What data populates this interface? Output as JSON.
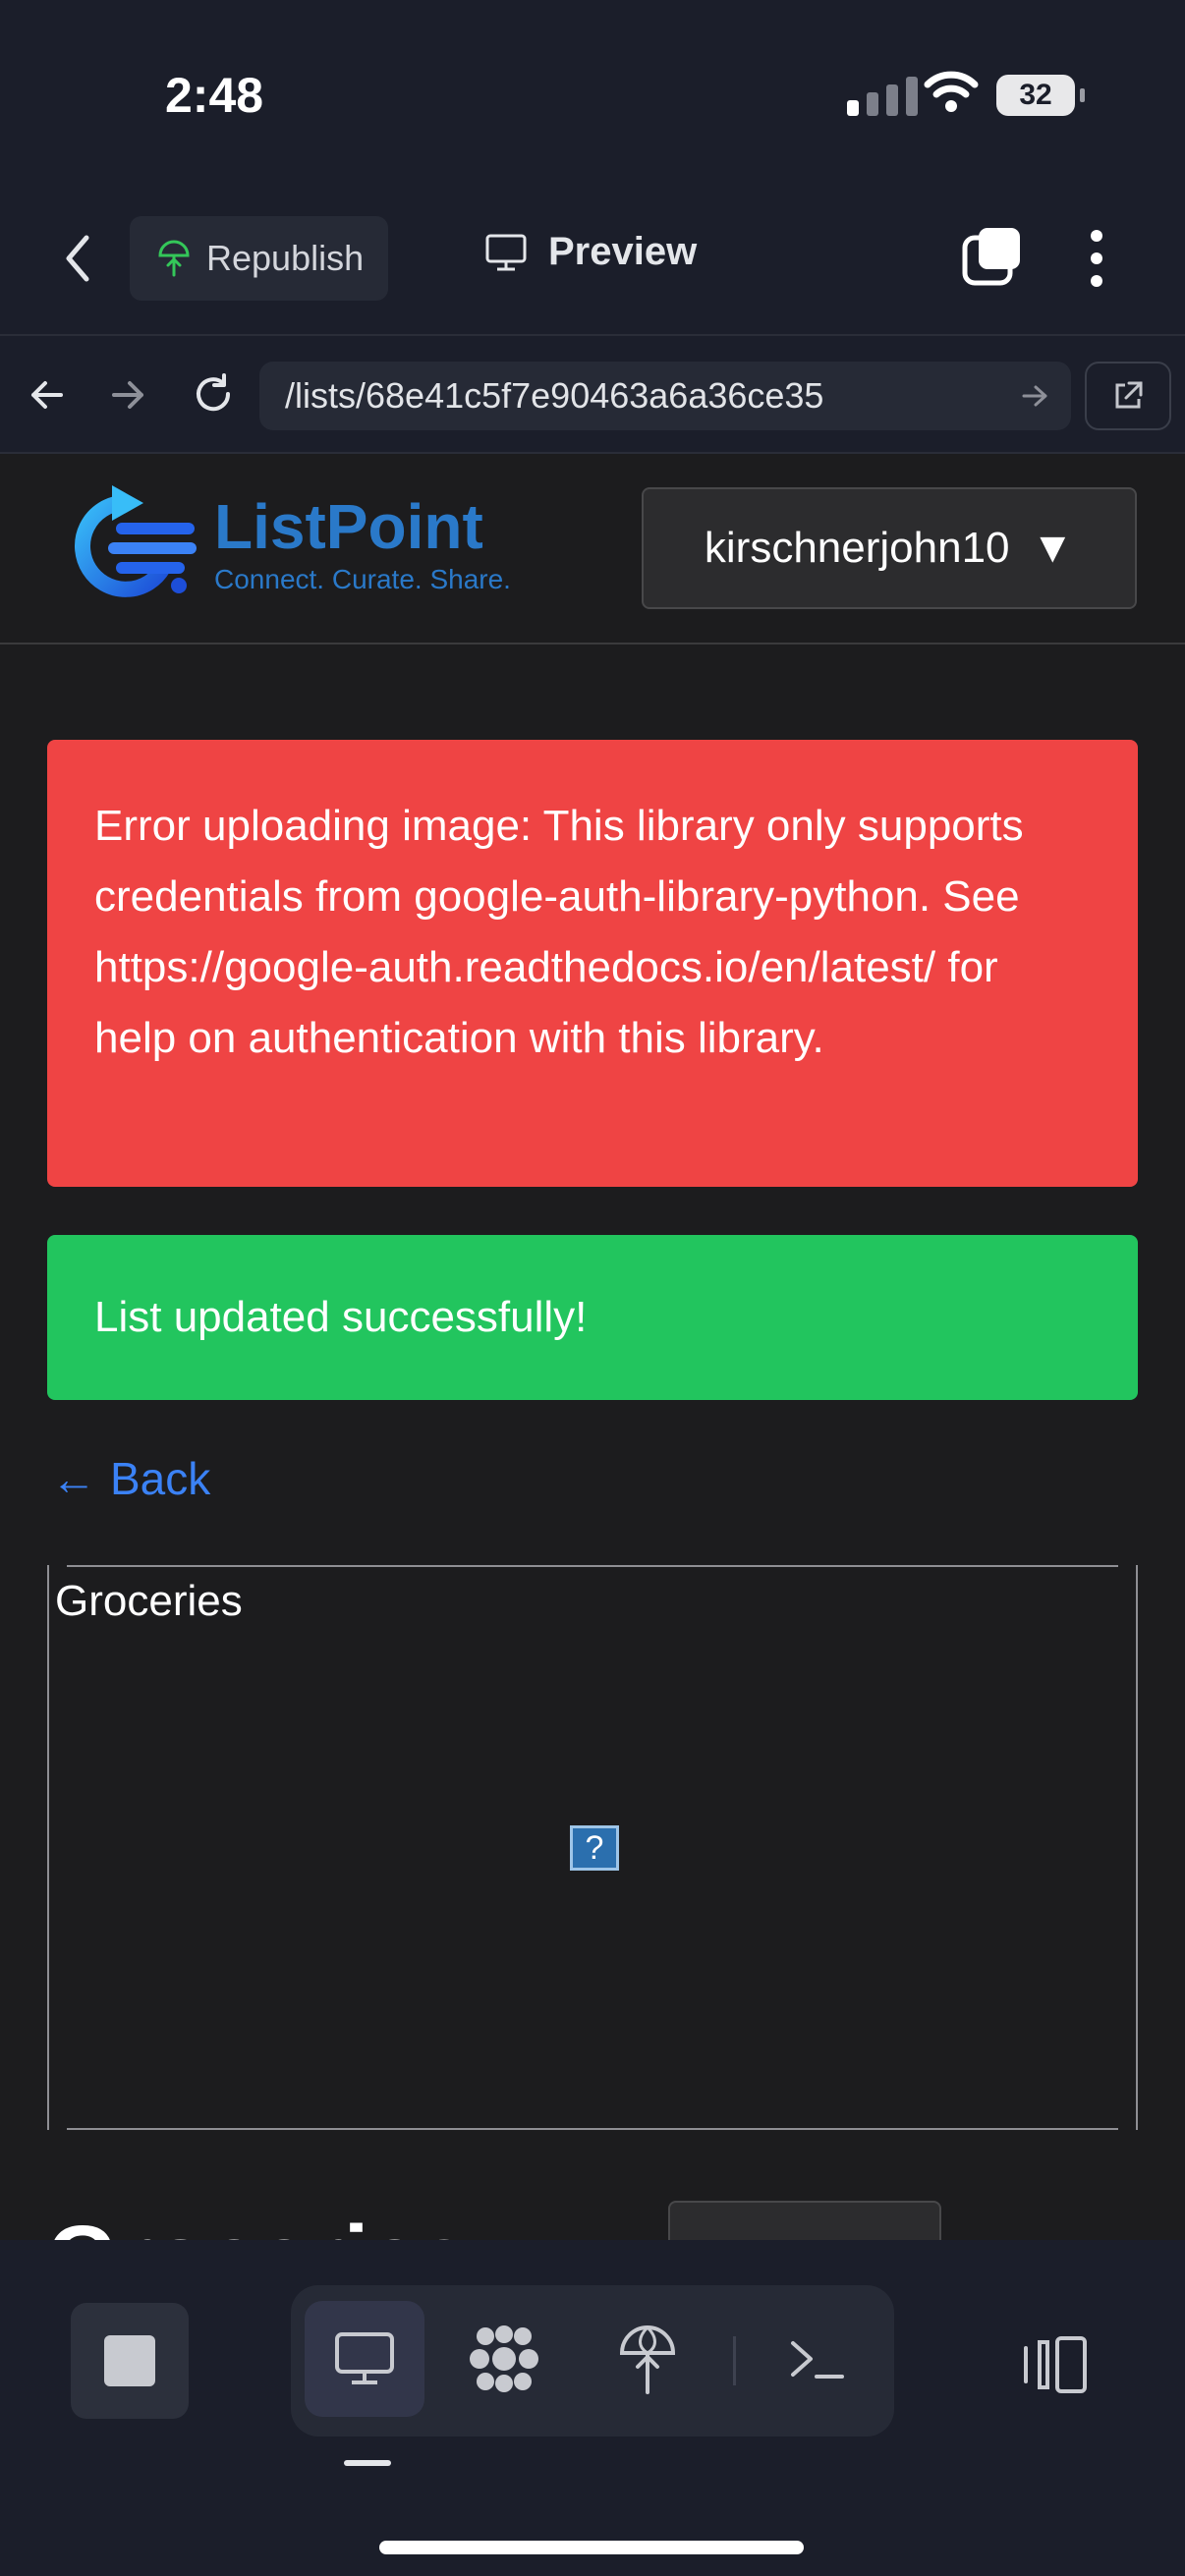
{
  "status_bar": {
    "time": "2:48",
    "battery": "32"
  },
  "app_header": {
    "republish_label": "Republish",
    "preview_label": "Preview"
  },
  "browser": {
    "url": "/lists/68e41c5f7e90463a6a36ce35"
  },
  "site_header": {
    "logo_name": "ListPoint",
    "logo_tagline": "Connect. Curate. Share.",
    "username": "kirschnerjohn10",
    "dropdown_caret": "▼"
  },
  "alerts": {
    "error_text": "Error uploading image: This library only supports credentials from google-auth-library-python. See https://google-auth.readthedocs.io/en/latest/ for help on authentication with this library.",
    "success_text": "List updated successfully!"
  },
  "back_link": {
    "arrow": "←",
    "label": "Back"
  },
  "card": {
    "title": "Groceries",
    "broken_image_glyph": "?"
  },
  "page": {
    "list_title": "Groceries"
  },
  "colors": {
    "error": "#ef4444",
    "success": "#22c55e",
    "link": "#3b82f6",
    "brand": "#2a79c9",
    "republish_icon": "#34c759"
  },
  "icons": [
    "back-chevron-icon",
    "republish-icon",
    "preview-monitor-icon",
    "tabs-icon",
    "more-icon",
    "browser-back-icon",
    "browser-forward-icon",
    "reload-icon",
    "url-go-icon",
    "open-external-icon",
    "stop-icon",
    "desktop-icon",
    "agents-icon",
    "deploy-icon",
    "terminal-icon",
    "sidebar-toggle-icon"
  ]
}
